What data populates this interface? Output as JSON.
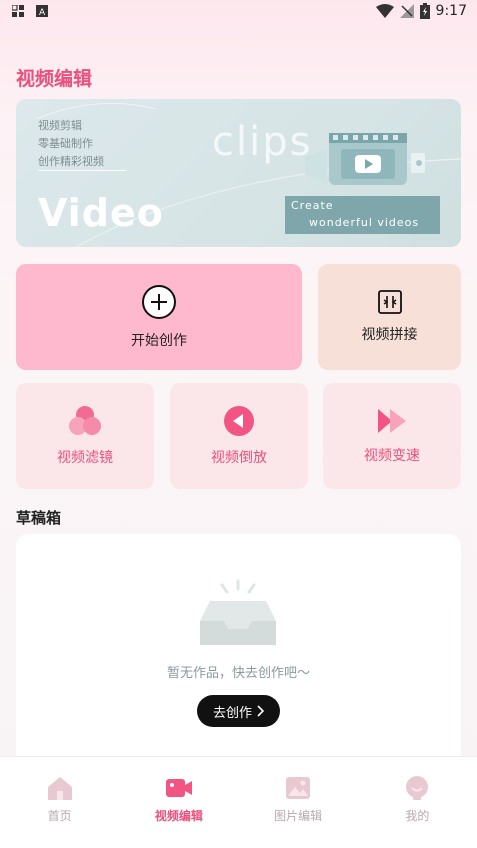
{
  "status_bar": {
    "time": "9:17"
  },
  "page_title": "视频编辑",
  "banner": {
    "lines": [
      "视频剪辑",
      "零基础制作",
      "创作精彩视频"
    ],
    "big_text": "Video",
    "clips_text": "clips",
    "create_line1": "Create",
    "create_line2": "wonderful videos"
  },
  "cards": {
    "start": {
      "label": "开始创作",
      "icon": "plus-circle-icon"
    },
    "splice": {
      "label": "视频拼接",
      "icon": "splice-icon"
    },
    "filter": {
      "label": "视频滤镜",
      "icon": "filter-circles-icon"
    },
    "reverse": {
      "label": "视频倒放",
      "icon": "reverse-play-icon"
    },
    "speed": {
      "label": "视频变速",
      "icon": "fast-forward-icon"
    }
  },
  "drafts": {
    "title": "草稿箱",
    "empty_text": "暂无作品，快去创作吧～",
    "button_label": "去创作"
  },
  "bottom_nav": [
    {
      "label": "首页",
      "icon": "home-icon"
    },
    {
      "label": "视频编辑",
      "icon": "video-camera-icon"
    },
    {
      "label": "图片编辑",
      "icon": "image-icon"
    },
    {
      "label": "我的",
      "icon": "profile-icon"
    }
  ],
  "colors": {
    "accent": "#ee4f7c",
    "start_card": "#ffb9cf",
    "splice_card": "#f6e0d8",
    "small_card": "#fbe7e9"
  }
}
